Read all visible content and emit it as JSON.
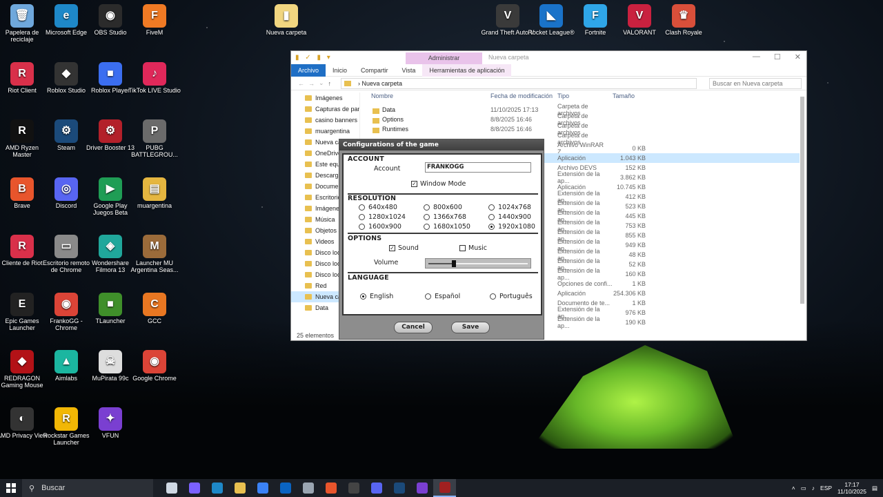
{
  "desktop": {
    "icons": [
      {
        "label": "Papelera de reciclaje",
        "color": "#6fa8dc",
        "glyph": "🗑",
        "icon": "recycle-bin-icon"
      },
      {
        "label": "Microsoft Edge",
        "color": "#1e88c8",
        "glyph": "e",
        "icon": "edge-icon"
      },
      {
        "label": "OBS Studio",
        "color": "#2b2b2b",
        "glyph": "◉",
        "icon": "obs-icon"
      },
      {
        "label": "FiveM",
        "color": "#f07a24",
        "glyph": "F",
        "icon": "fivem-icon"
      },
      {
        "label": "Riot Client",
        "color": "#d9304a",
        "glyph": "R",
        "icon": "riot-icon"
      },
      {
        "label": "Roblox Studio",
        "color": "#333333",
        "glyph": "◆",
        "icon": "roblox-studio-icon"
      },
      {
        "label": "Roblox Player",
        "color": "#3b6ef0",
        "glyph": "■",
        "icon": "roblox-player-icon"
      },
      {
        "label": "TikTok LIVE Studio",
        "color": "#e0285a",
        "glyph": "♪",
        "icon": "tiktok-icon"
      },
      {
        "label": "AMD Ryzen Master",
        "color": "#111111",
        "glyph": "R",
        "icon": "ryzen-icon"
      },
      {
        "label": "Steam",
        "color": "#1b4a7a",
        "glyph": "⚙",
        "icon": "steam-icon"
      },
      {
        "label": "Driver Booster 13",
        "color": "#b3202a",
        "glyph": "⚙",
        "icon": "driver-booster-icon"
      },
      {
        "label": "PUBG BATTLEGROU...",
        "color": "#6b6b6b",
        "glyph": "P",
        "icon": "pubg-icon"
      },
      {
        "label": "Brave",
        "color": "#e8552c",
        "glyph": "B",
        "icon": "brave-icon"
      },
      {
        "label": "Discord",
        "color": "#5865f2",
        "glyph": "◎",
        "icon": "discord-icon"
      },
      {
        "label": "Google Play Juegos Beta",
        "color": "#1f9d55",
        "glyph": "▶",
        "icon": "google-play-icon"
      },
      {
        "label": "muargentina",
        "color": "#e5b640",
        "glyph": "▤",
        "icon": "muargentina-icon"
      },
      {
        "label": "Cliente de Riot",
        "color": "#d9304a",
        "glyph": "R",
        "icon": "riot-client-icon"
      },
      {
        "label": "Escritorio remoto de Chrome",
        "color": "#8a8a8a",
        "glyph": "▭",
        "icon": "remote-desktop-icon"
      },
      {
        "label": "Wondershare Filmora 13",
        "color": "#20a79b",
        "glyph": "◈",
        "icon": "filmora-icon"
      },
      {
        "label": "Launcher MU Argentina Seas...",
        "color": "#9b6b3a",
        "glyph": "M",
        "icon": "mu-launcher-icon"
      },
      {
        "label": "Epic Games Launcher",
        "color": "#222222",
        "glyph": "E",
        "icon": "epic-games-icon"
      },
      {
        "label": "FrankoGG - Chrome",
        "color": "#db4437",
        "glyph": "◉",
        "icon": "chrome-profile-icon"
      },
      {
        "label": "TLauncher",
        "color": "#3f8f2a",
        "glyph": "■",
        "icon": "tlauncher-icon"
      },
      {
        "label": "GCC",
        "color": "#e87722",
        "glyph": "C",
        "icon": "gcc-icon"
      },
      {
        "label": "REDRAGON Gaming Mouse",
        "color": "#b31217",
        "glyph": "◆",
        "icon": "redragon-icon"
      },
      {
        "label": "Aimlabs",
        "color": "#1bb6a0",
        "glyph": "▲",
        "icon": "aimlabs-icon"
      },
      {
        "label": "MuPirata 99c",
        "color": "#dddddd",
        "glyph": "☠",
        "icon": "mupirata-icon"
      },
      {
        "label": "Google Chrome",
        "color": "#db4437",
        "glyph": "◉",
        "icon": "google-chrome-icon"
      },
      {
        "label": "AMD Privacy View",
        "color": "#333333",
        "glyph": "◐",
        "icon": "amd-privacy-icon"
      },
      {
        "label": "Rockstar Games Launcher",
        "color": "#f2b705",
        "glyph": "R",
        "icon": "rockstar-icon"
      },
      {
        "label": "VFUN",
        "color": "#7a3fd1",
        "glyph": "✦",
        "icon": "vfun-icon"
      },
      {
        "label": "Nueva carpeta",
        "color": "#f1d680",
        "glyph": "▮",
        "icon": "folder-icon"
      },
      {
        "label": "Grand Theft Auto V",
        "color": "#3a3a3a",
        "glyph": "V",
        "icon": "gta-icon"
      },
      {
        "label": "Rocket League®",
        "color": "#1a73c9",
        "glyph": "◣",
        "icon": "rocket-league-icon"
      },
      {
        "label": "Fortnite",
        "color": "#2fa6e8",
        "glyph": "F",
        "icon": "fortnite-icon"
      },
      {
        "label": "VALORANT",
        "color": "#c9213f",
        "glyph": "V",
        "icon": "valorant-icon"
      },
      {
        "label": "Clash Royale",
        "color": "#d94f3a",
        "glyph": "♛",
        "icon": "clash-royale-icon"
      }
    ]
  },
  "explorer": {
    "admin_tab": "Administrar",
    "window_title": "Nueva carpeta",
    "ribbon": [
      "Archivo",
      "Inicio",
      "Compartir",
      "Vista",
      "Herramientas de aplicación"
    ],
    "path": "Nueva carpeta",
    "search_placeholder": "Buscar en Nueva carpeta",
    "nav": [
      {
        "label": "Imágenes",
        "sel": false
      },
      {
        "label": "Capturas de pan",
        "sel": false
      },
      {
        "label": "casino banners",
        "sel": false
      },
      {
        "label": "muargentina",
        "sel": false
      },
      {
        "label": "Nueva car",
        "sel": false
      },
      {
        "label": "OneDrive -",
        "sel": false
      },
      {
        "label": "Este equipo",
        "sel": false
      },
      {
        "label": "Descargas",
        "sel": false
      },
      {
        "label": "Documen",
        "sel": false
      },
      {
        "label": "Escritorio",
        "sel": false
      },
      {
        "label": "Imágenes",
        "sel": false
      },
      {
        "label": "Música",
        "sel": false
      },
      {
        "label": "Objetos 3",
        "sel": false
      },
      {
        "label": "Videos",
        "sel": false
      },
      {
        "label": "Disco loca",
        "sel": false
      },
      {
        "label": "Disco loca",
        "sel": false
      },
      {
        "label": "Disco local",
        "sel": false
      },
      {
        "label": "Red",
        "sel": false
      },
      {
        "label": "Nueva carp",
        "sel": true
      },
      {
        "label": "Data",
        "sel": false
      }
    ],
    "columns": {
      "name": "Nombre",
      "date": "Fecha de modificación",
      "type": "Tipo",
      "size": "Tamaño"
    },
    "rows": [
      {
        "name": "Data",
        "date": "11/10/2025 17:13",
        "type": "Carpeta de archivos",
        "size": ""
      },
      {
        "name": "Options",
        "date": "8/8/2025 16:46",
        "type": "Carpeta de archivos",
        "size": ""
      },
      {
        "name": "Runtimes",
        "date": "8/8/2025 16:46",
        "type": "Carpeta de archivos",
        "size": ""
      },
      {
        "name": "",
        "date": "",
        "type": "Carpeta de archivos",
        "size": ""
      },
      {
        "name": "",
        "date": "",
        "type": "Archivo WinRAR Z...",
        "size": "0 KB"
      },
      {
        "name": "",
        "date": "",
        "type": "Aplicación",
        "size": "1.043 KB"
      },
      {
        "name": "",
        "date": "",
        "type": "Archivo DEVS",
        "size": "152 KB"
      },
      {
        "name": "",
        "date": "",
        "type": "Extensión de la ap...",
        "size": "3.862 KB"
      },
      {
        "name": "",
        "date": "",
        "type": "Aplicación",
        "size": "10.745 KB"
      },
      {
        "name": "",
        "date": "",
        "type": "Extensión de la ap...",
        "size": "412 KB"
      },
      {
        "name": "",
        "date": "",
        "type": "Extensión de la ap...",
        "size": "523 KB"
      },
      {
        "name": "",
        "date": "",
        "type": "Extensión de la ap...",
        "size": "445 KB"
      },
      {
        "name": "",
        "date": "",
        "type": "Extensión de la ap...",
        "size": "753 KB"
      },
      {
        "name": "",
        "date": "",
        "type": "Extensión de la ap...",
        "size": "855 KB"
      },
      {
        "name": "",
        "date": "",
        "type": "Extensión de la ap...",
        "size": "949 KB"
      },
      {
        "name": "",
        "date": "",
        "type": "Extensión de la ap...",
        "size": "48 KB"
      },
      {
        "name": "",
        "date": "",
        "type": "Extensión de la ap...",
        "size": "52 KB"
      },
      {
        "name": "",
        "date": "",
        "type": "Extensión de la ap...",
        "size": "160 KB"
      },
      {
        "name": "",
        "date": "",
        "type": "Opciones de confi...",
        "size": "1 KB"
      },
      {
        "name": "",
        "date": "",
        "type": "Aplicación",
        "size": "254.306 KB"
      },
      {
        "name": "",
        "date": "",
        "type": "Documento de te...",
        "size": "1 KB"
      },
      {
        "name": "",
        "date": "",
        "type": "Extensión de la ap...",
        "size": "976 KB"
      },
      {
        "name": "",
        "date": "",
        "type": "Extensión de la ap...",
        "size": "190 KB"
      }
    ],
    "status": "25 elementos"
  },
  "dialog": {
    "title": "Configurations of the game",
    "account": {
      "heading": "ACCOUNT",
      "label": "Account",
      "value": "FRANKOGG",
      "window_mode": "Window Mode",
      "window_mode_checked": true
    },
    "resolution": {
      "heading": "RESOLUTION",
      "options": [
        "640x480",
        "800x600",
        "1024x768",
        "1280x1024",
        "1366x768",
        "1440x900",
        "1600x900",
        "1680x1050",
        "1920x1080"
      ],
      "selected": "1920x1080"
    },
    "options": {
      "heading": "OPTIONS",
      "sound": "Sound",
      "sound_checked": true,
      "music": "Music",
      "music_checked": false,
      "volume_label": "Volume",
      "volume": 0.25
    },
    "language": {
      "heading": "LANGUAGE",
      "options": [
        "English",
        "Español",
        "Português"
      ],
      "selected": "English"
    },
    "cancel": "Cancel",
    "save": "Save"
  },
  "taskbar": {
    "search": "Buscar",
    "apps": [
      {
        "icon": "task-view-icon",
        "color": "#cfd8e3"
      },
      {
        "icon": "copilot-icon",
        "color": "#7b61ff"
      },
      {
        "icon": "edge-icon",
        "color": "#1e88c8"
      },
      {
        "icon": "file-explorer-icon",
        "color": "#e8c050"
      },
      {
        "icon": "store-icon",
        "color": "#3b82f6"
      },
      {
        "icon": "outlook-icon",
        "color": "#0a64c2"
      },
      {
        "icon": "photos-icon",
        "color": "#9aa5b1"
      },
      {
        "icon": "brave-icon",
        "color": "#e8552c"
      },
      {
        "icon": "obs-icon",
        "color": "#444444"
      },
      {
        "icon": "discord-icon",
        "color": "#5865f2"
      },
      {
        "icon": "steam-icon",
        "color": "#1b4a7a"
      },
      {
        "icon": "vfun-icon",
        "color": "#7a3fd1"
      },
      {
        "icon": "mu-game-icon",
        "color": "#a02020"
      }
    ],
    "language": "ESP",
    "time": "17:17",
    "date": "11/10/2025"
  }
}
